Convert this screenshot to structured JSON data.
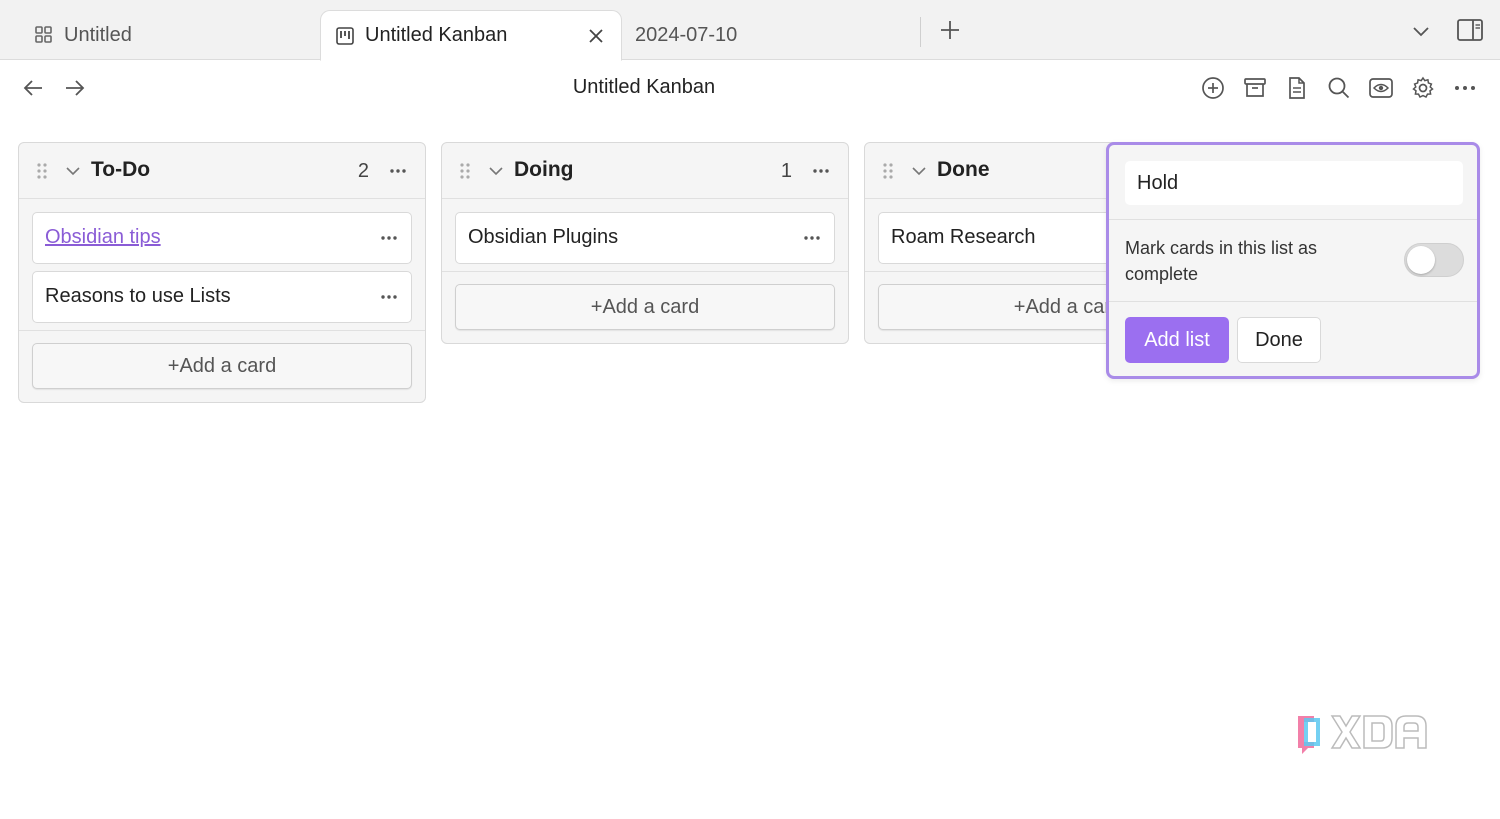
{
  "tabs": [
    {
      "label": "Untitled",
      "icon": "grid-icon"
    },
    {
      "label": "Untitled Kanban",
      "icon": "kanban-icon",
      "active": true
    },
    {
      "label": "2024-07-10"
    }
  ],
  "header": {
    "title": "Untitled Kanban"
  },
  "lanes": [
    {
      "title": "To-Do",
      "count": "2",
      "cards": [
        {
          "text": "Obsidian tips",
          "link": true
        },
        {
          "text": "Reasons to use Lists",
          "link": false
        }
      ],
      "add_label": "+Add a card"
    },
    {
      "title": "Doing",
      "count": "1",
      "cards": [
        {
          "text": "Obsidian Plugins",
          "link": false
        }
      ],
      "add_label": "+Add a card"
    },
    {
      "title": "Done",
      "count": "",
      "cards": [
        {
          "text": "Roam Research",
          "link": false
        }
      ],
      "add_label": "+Add a card"
    }
  ],
  "new_list": {
    "input_value": "Hold",
    "complete_label": "Mark cards in this list as complete",
    "complete_enabled": false,
    "add_label": "Add list",
    "done_label": "Done"
  },
  "colors": {
    "accent": "#9b6ff0",
    "accent_border": "#a98be8",
    "link": "#8a5cd6"
  },
  "watermark": "XDA"
}
